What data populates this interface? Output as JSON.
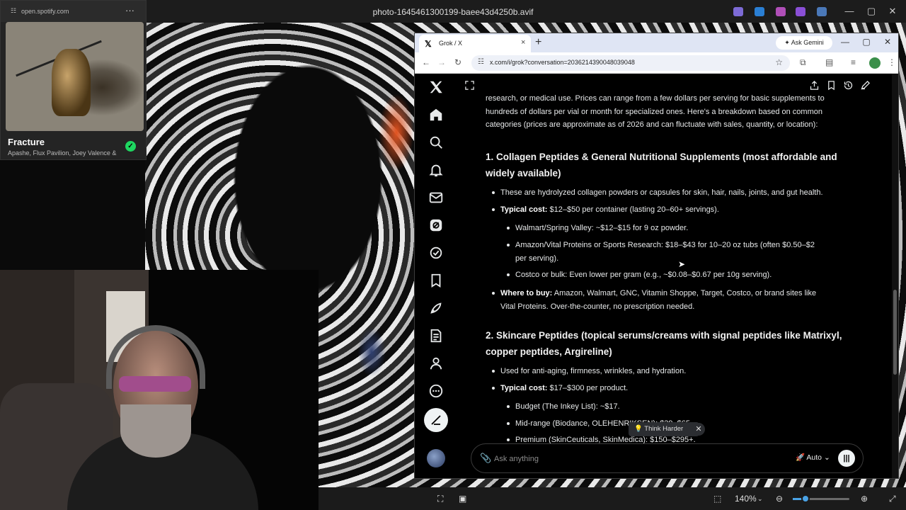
{
  "viewer": {
    "title": "photo-1645461300199-baee43d4250b.avif",
    "zoom": "140%"
  },
  "spotify": {
    "url": "open.spotify.com",
    "track_title": "Fracture",
    "artists": "Apashe, Flux Pavilion, Joey Valence & Br"
  },
  "browser": {
    "tab_title": "Grok / X",
    "gemini_label": "Ask Gemini",
    "url": "x.com/i/grok?conversation=2036214390048039048"
  },
  "grok": {
    "intro": "research, or medical use. Prices can range from a few dollars per serving for basic supplements to hundreds of dollars per vial or month for specialized ones. Here's a breakdown based on common categories (prices are approximate as of 2026 and can fluctuate with sales, quantity, or location):",
    "section1": {
      "heading": "1. Collagen Peptides & General Nutritional Supplements (most affordable and widely available)",
      "bullet1": "These are hydrolyzed collagen powders or capsules for skin, hair, nails, joints, and gut health.",
      "cost_label": "Typical cost:",
      "cost_text": " $12–$50 per container (lasting 20–60+ servings).",
      "sub1": "Walmart/Spring Valley: ~$12–$15 for 9 oz powder.",
      "sub2": "Amazon/Vital Proteins or Sports Research: $18–$43 for 10–20 oz tubs (often $0.50–$2 per serving).",
      "sub3": "Costco or bulk: Even lower per gram (e.g., ~$0.08–$0.67 per 10g serving).",
      "where_label": "Where to buy:",
      "where_text": " Amazon, Walmart, GNC, Vitamin Shoppe, Target, Costco, or brand sites like Vital Proteins. Over-the-counter, no prescription needed."
    },
    "section2": {
      "heading": "2. Skincare Peptides (topical serums/creams with signal peptides like Matrixyl, copper peptides, Argireline)",
      "bullet1": "Used for anti-aging, firmness, wrinkles, and hydration.",
      "cost_label": "Typical cost:",
      "cost_text": " $17–$300 per product.",
      "sub1": "Budget (The Inkey List): ~$17.",
      "sub2": "Mid-range (Biodance, OLEHENRIKSEN): $39–$65.",
      "sub3": "Premium (SkinCeuticals, SkinMedica): $150–$295+."
    },
    "think_harder": "Think Harder",
    "composer_placeholder": "Ask anything",
    "model": "Auto"
  }
}
